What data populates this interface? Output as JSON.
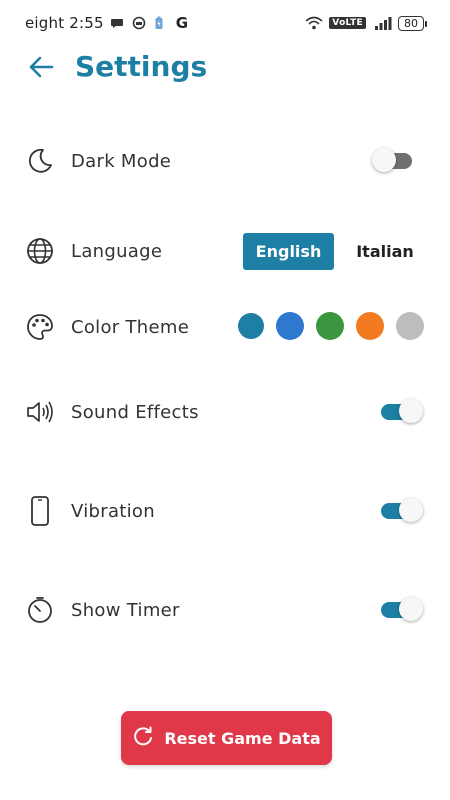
{
  "status_bar": {
    "time": "eight 2:55",
    "carrier_badge": "VoLTE",
    "battery": "80",
    "google_letter": "G"
  },
  "header": {
    "title": "Settings"
  },
  "settings": {
    "dark_mode": {
      "label": "Dark Mode",
      "enabled": false
    },
    "language": {
      "label": "Language",
      "options": [
        "English",
        "Italian"
      ],
      "selected": "English"
    },
    "color_theme": {
      "label": "Color Theme",
      "colors": [
        "#1d7fa3",
        "#2e78d0",
        "#3c9640",
        "#f27b22",
        "#bdbdbd"
      ],
      "selected_index": 0
    },
    "sound_effects": {
      "label": "Sound Effects",
      "enabled": true
    },
    "vibration": {
      "label": "Vibration",
      "enabled": true
    },
    "show_timer": {
      "label": "Show Timer",
      "enabled": true
    }
  },
  "reset": {
    "label": "Reset Game Data",
    "color": "#e03848"
  },
  "accent_color": "#1d7fa3"
}
